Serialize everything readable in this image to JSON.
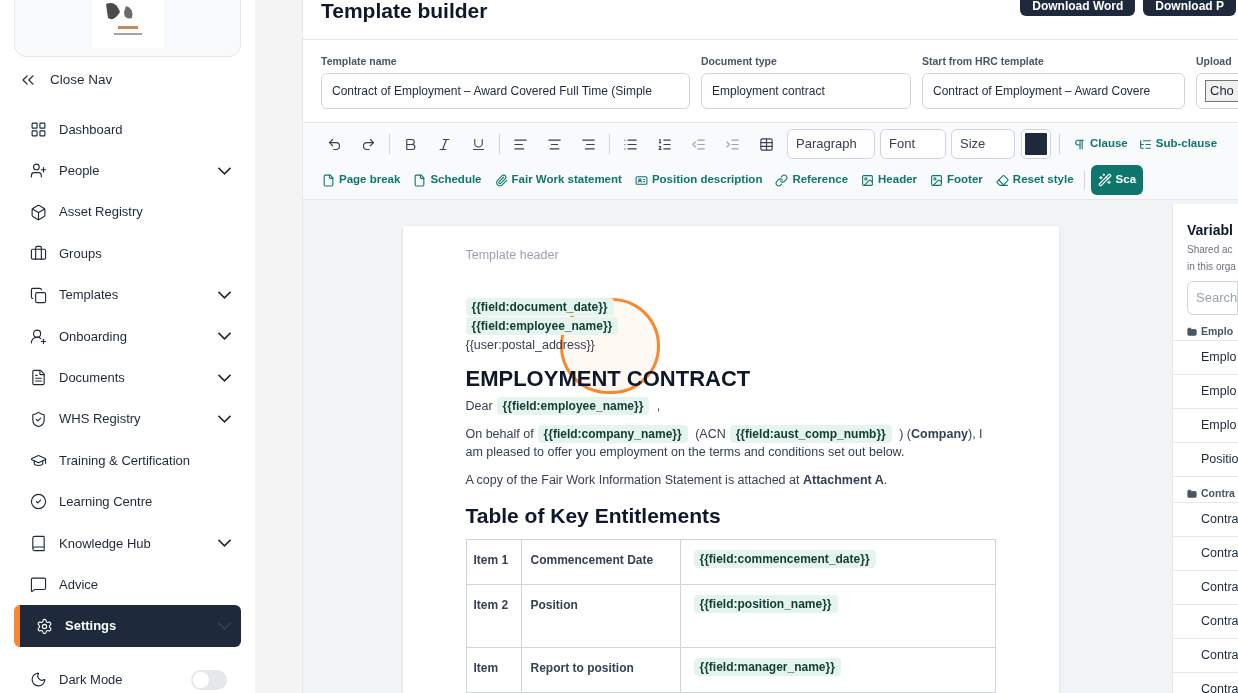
{
  "sidebar": {
    "close_nav": "Close Nav",
    "items": [
      {
        "label": "Dashboard",
        "kind": "link",
        "selected": false
      },
      {
        "label": "People",
        "kind": "group",
        "selected": false
      },
      {
        "label": "Asset Registry",
        "kind": "link",
        "selected": false
      },
      {
        "label": "Groups",
        "kind": "link",
        "selected": false
      },
      {
        "label": "Templates",
        "kind": "group",
        "selected": false
      },
      {
        "label": "Onboarding",
        "kind": "group",
        "selected": false
      },
      {
        "label": "Documents",
        "kind": "group",
        "selected": false
      },
      {
        "label": "WHS Registry",
        "kind": "group",
        "selected": false
      },
      {
        "label": "Training & Certification",
        "kind": "link",
        "selected": false
      },
      {
        "label": "Learning Centre",
        "kind": "link",
        "selected": false
      },
      {
        "label": "Knowledge Hub",
        "kind": "group",
        "selected": false
      },
      {
        "label": "Advice",
        "kind": "link",
        "selected": false
      },
      {
        "label": "Settings",
        "kind": "group",
        "selected": true
      }
    ],
    "dark_mode": {
      "label": "Dark Mode",
      "on": false
    }
  },
  "header": {
    "title": "Template builder",
    "buttons": [
      "Download Word",
      "Download P"
    ]
  },
  "fields": [
    {
      "label": "Template name",
      "value": "Contract of Employment – Award Covered Full Time (Simple"
    },
    {
      "label": "Document type",
      "value": "Employment contract"
    },
    {
      "label": "Start from HRC template",
      "value": "Contract of Employment – Award Covere"
    }
  ],
  "upload": {
    "label": "Upload",
    "button": "Cho"
  },
  "toolbar": {
    "selects": [
      "Paragraph",
      "Font",
      "Size"
    ],
    "color": "#1e293b",
    "actions": [
      "Clause",
      "Sub-clause"
    ],
    "inserts": [
      "Page break",
      "Schedule",
      "Fair Work statement",
      "Position description",
      "Reference",
      "Header",
      "Footer",
      "Reset style"
    ],
    "scan": "Sca"
  },
  "document": {
    "header_placeholder": "Template header",
    "address": [
      {
        "kind": "field",
        "text": "{{field:document_date}}"
      },
      {
        "kind": "field",
        "text": "{{field:employee_name}}"
      },
      {
        "kind": "text",
        "text": "{{user:postal_address}}"
      }
    ],
    "title": "EMPLOYMENT CONTRACT",
    "paragraphs": [
      [
        {
          "kind": "text",
          "text": "Dear"
        },
        {
          "kind": "field",
          "text": "{{field:employee_name}}"
        },
        {
          "kind": "text",
          "text": ","
        }
      ],
      [
        {
          "kind": "text",
          "text": "On behalf of"
        },
        {
          "kind": "field",
          "text": "{{field:company_name}}"
        },
        {
          "kind": "text",
          "text": "(ACN"
        },
        {
          "kind": "field",
          "text": "{{field:aust_comp_numb}}"
        },
        {
          "kind": "text",
          "text": ") (**Company**), I am pleased to offer you employment on the terms and conditions set out below."
        }
      ],
      [
        {
          "kind": "text",
          "text": "A copy of the Fair Work Information Statement is attached at **Attachment A**."
        }
      ]
    ],
    "table_title": "Table of Key Entitlements",
    "table_rows": [
      {
        "item": "Item 1",
        "label": "Commencement Date",
        "field": "{{field:commencement_date}}"
      },
      {
        "item": "Item 2",
        "label": "Position",
        "field": "{{field:position_name}}"
      },
      {
        "item": "Item",
        "label": "Report to position",
        "field": "{{field:manager_name}}"
      }
    ]
  },
  "variables": {
    "title": "Variabl",
    "subtitle": [
      "Shared ac",
      "in this orga"
    ],
    "search_placeholder": "Search",
    "groups": [
      {
        "name": "Emplo",
        "items": [
          "Emplo",
          "Emplo",
          "Emplo",
          "Positio"
        ]
      },
      {
        "name": "Contra",
        "items": [
          "Contra",
          "Contra",
          "Contra",
          "Contra",
          "Contra",
          "Contra"
        ]
      }
    ]
  }
}
